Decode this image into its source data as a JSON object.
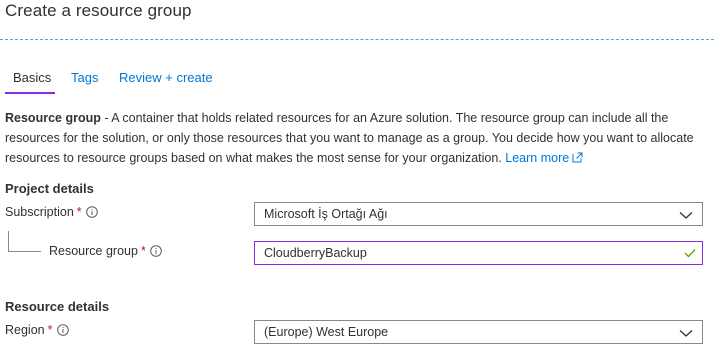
{
  "page": {
    "title": "Create a resource group"
  },
  "tabs": [
    {
      "label": "Basics",
      "active": true
    },
    {
      "label": "Tags",
      "active": false
    },
    {
      "label": "Review + create",
      "active": false
    }
  ],
  "description": {
    "bold": "Resource group",
    "text": " - A container that holds related resources for an Azure solution. The resource group can include all the resources for the solution, or only those resources that you want to manage as a group. You decide how you want to allocate resources to resource groups based on what makes the most sense for your organization. ",
    "link": "Learn more"
  },
  "project_details": {
    "heading": "Project details",
    "subscription": {
      "label": "Subscription",
      "required": "*",
      "value": "Microsoft İş Ortağı Ağı"
    },
    "resource_group": {
      "label": "Resource group",
      "required": "*",
      "value": "CloudberryBackup"
    }
  },
  "resource_details": {
    "heading": "Resource details",
    "region": {
      "label": "Region",
      "required": "*",
      "value": "(Europe) West Europe"
    }
  },
  "icons": {
    "info": "info-icon",
    "chevron": "chevron-down-icon",
    "check": "checkmark-icon",
    "external": "external-link-icon"
  },
  "colors": {
    "accent": "#0078d4",
    "tab_underline": "#8a2be2",
    "valid_check": "#57a300",
    "required": "#a4262c"
  }
}
